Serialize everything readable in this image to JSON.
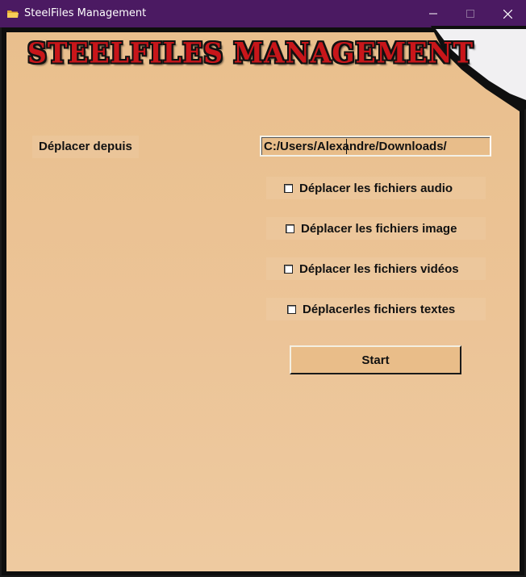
{
  "window": {
    "title": "SteelFiles Management",
    "icon": "folder-icon",
    "controls": {
      "minimize": "minimize-icon",
      "maximize": "maximize-icon",
      "close": "close-icon"
    }
  },
  "header": {
    "logo_text": "STEELFILES MANAGEMENT"
  },
  "form": {
    "source_label": "Déplacer depuis",
    "source_path": "C:/Users/Alexandre/Downloads/",
    "options": [
      {
        "label": "Déplacer les fichiers audio",
        "checked": false
      },
      {
        "label": "Déplacer les fichiers image",
        "checked": false
      },
      {
        "label": "Déplacer les fichiers vidéos",
        "checked": false
      },
      {
        "label": "Déplacerles fichiers textes",
        "checked": false
      }
    ],
    "start_label": "Start"
  },
  "colors": {
    "titlebar": "#4b1a62",
    "panel": "#e9bf8d",
    "logo_red": "#c8161a"
  }
}
